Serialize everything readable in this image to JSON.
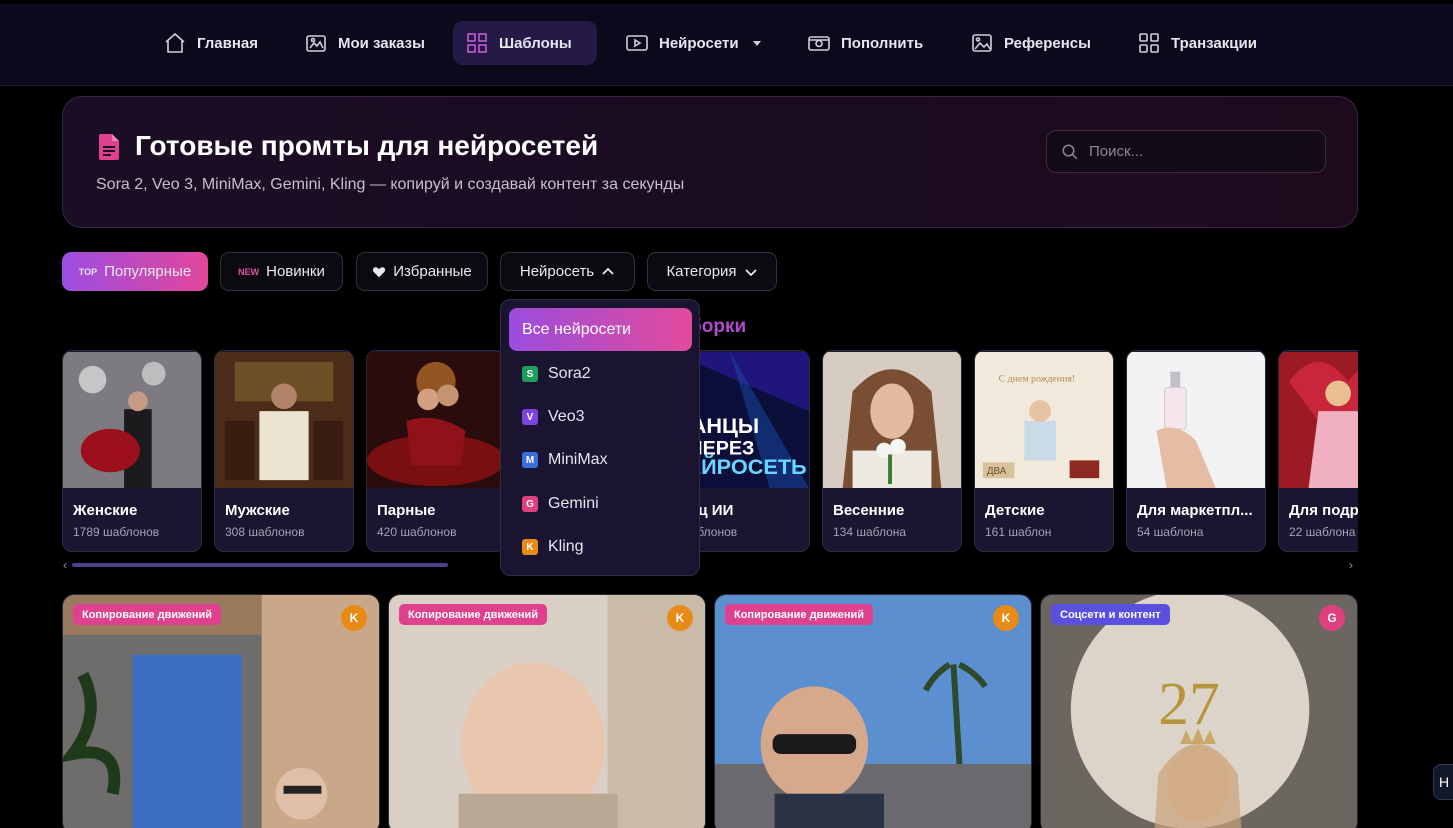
{
  "nav": {
    "items": [
      {
        "label": "Главная",
        "icon": "home-icon"
      },
      {
        "label": "Мои заказы",
        "icon": "images-icon"
      },
      {
        "label": "Шаблоны",
        "icon": "templates-icon",
        "active": true
      },
      {
        "label": "Нейросети",
        "icon": "play-icon"
      },
      {
        "label": "Пополнить",
        "icon": "wallet-icon"
      },
      {
        "label": "Референсы",
        "icon": "image-icon"
      },
      {
        "label": "Транзакции",
        "icon": "grid-icon"
      }
    ]
  },
  "hero": {
    "title": "Готовые промты для нейросетей",
    "subtitle": "Sora 2, Veo 3, MiniMax, Gemini, Kling — копируй и создавай контент за секунды",
    "search_placeholder": "Поиск..."
  },
  "filters": {
    "popular": {
      "tag": "TOP",
      "label": "Популярные"
    },
    "new": {
      "tag": "NEW",
      "label": "Новинки"
    },
    "favorites": {
      "label": "Избранные"
    },
    "network": {
      "label": "Нейросеть"
    },
    "category": {
      "label": "Категория"
    }
  },
  "section_heading": "борки",
  "dropdown": {
    "all": "Все нейросети",
    "items": [
      {
        "letter": "S",
        "label": "Sora2",
        "color": "#1e9e5a"
      },
      {
        "letter": "V",
        "label": "Veo3",
        "color": "#7a44e0"
      },
      {
        "letter": "M",
        "label": "MiniMax",
        "color": "#3a6fe0"
      },
      {
        "letter": "G",
        "label": "Gemini",
        "color": "#e0407e"
      },
      {
        "letter": "K",
        "label": "Kling",
        "color": "#e88b16"
      }
    ]
  },
  "categories": [
    {
      "title": "Женские",
      "count": "1789 шаблонов"
    },
    {
      "title": "Мужские",
      "count": "308 шаблонов"
    },
    {
      "title": "Парные",
      "count": "420 шаблонов"
    },
    {
      "title": "",
      "count": ""
    },
    {
      "title": "нец ИИ",
      "count": "шаблонов",
      "overlay_lines": [
        "ТАНЦЫ",
        "ЧЕРЕЗ",
        "НЕЙРОСЕТЬ"
      ]
    },
    {
      "title": "Весенние",
      "count": "134 шаблона"
    },
    {
      "title": "Детские",
      "count": "161 шаблон",
      "photo_caption": "С днем рождения!",
      "blocks_text": "ДВА"
    },
    {
      "title": "Для маркетпл...",
      "count": "54 шаблона"
    },
    {
      "title": "Для подру",
      "count": "22 шаблона"
    }
  ],
  "cards": [
    {
      "tag": "Копирование движений",
      "badge": "K",
      "tag_color": "#e0418e",
      "badge_color": "#e88b16"
    },
    {
      "tag": "Копирование движений",
      "badge": "K",
      "tag_color": "#e0418e",
      "badge_color": "#e88b16"
    },
    {
      "tag": "Копирование движений",
      "badge": "K",
      "tag_color": "#e0418e",
      "badge_color": "#e88b16"
    },
    {
      "tag": "Соцсети и контент",
      "badge": "G",
      "tag_color": "#5b4fe0",
      "badge_color": "#e0407e",
      "big_number": "27"
    }
  ],
  "side_button": "Н"
}
